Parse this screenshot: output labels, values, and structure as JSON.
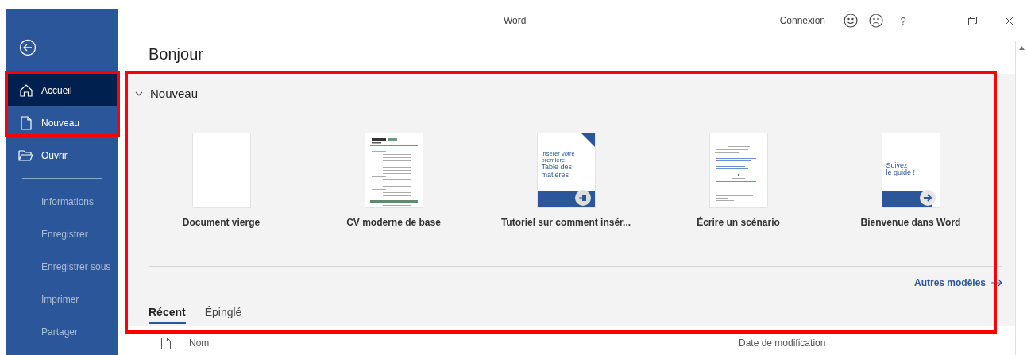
{
  "window": {
    "title": "Word",
    "account": "Connexion",
    "help": "?"
  },
  "sidebar": {
    "items": [
      {
        "kind": "home",
        "label": "Accueil",
        "selected": true,
        "disabled": false
      },
      {
        "kind": "new",
        "label": "Nouveau",
        "selected": false,
        "disabled": false
      },
      {
        "kind": "open",
        "label": "Ouvrir",
        "selected": false,
        "disabled": false
      },
      {
        "kind": "separator"
      },
      {
        "kind": "plain",
        "label": "Informations",
        "selected": false,
        "disabled": true
      },
      {
        "kind": "plain",
        "label": "Enregistrer",
        "selected": false,
        "disabled": true
      },
      {
        "kind": "plain",
        "label": "Enregistrer sous",
        "selected": false,
        "disabled": true
      },
      {
        "kind": "plain",
        "label": "Imprimer",
        "selected": false,
        "disabled": true
      },
      {
        "kind": "plain",
        "label": "Partager",
        "selected": false,
        "disabled": true
      }
    ]
  },
  "main": {
    "greeting": "Bonjour",
    "new_section": {
      "title": "Nouveau",
      "expanded": true,
      "templates": [
        {
          "name": "Document vierge",
          "kind": "blank"
        },
        {
          "name": "CV moderne de base",
          "kind": "resume"
        },
        {
          "name": "Tutoriel sur comment insér...",
          "kind": "toc",
          "thumb_lines": [
            "Insérer votre",
            "première"
          ],
          "thumb_title": [
            "Table des",
            "matières"
          ]
        },
        {
          "name": "Écrire un scénario",
          "kind": "script"
        },
        {
          "name": "Bienvenue dans Word",
          "kind": "welcome",
          "thumb_lines": [
            "Suivez",
            "le guide !"
          ]
        }
      ],
      "more_link": "Autres modèles"
    },
    "tabs": [
      {
        "label": "Récent",
        "selected": true
      },
      {
        "label": "Épinglé",
        "selected": false
      }
    ],
    "file_columns": [
      "Nom",
      "Date de modification"
    ]
  }
}
